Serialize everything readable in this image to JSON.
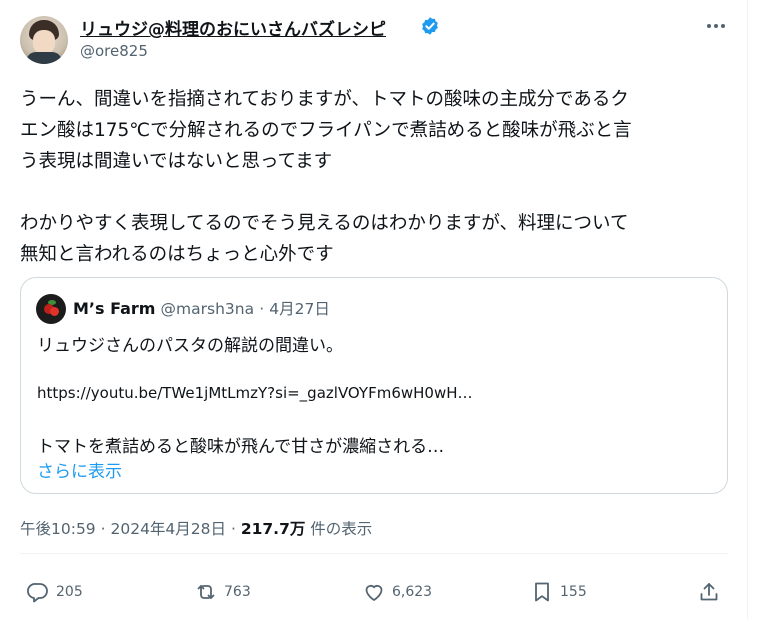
{
  "author": {
    "display_name": "リュウジ@料理のおにいさんバズレシピ",
    "handle": "@ore825"
  },
  "tweet": {
    "lines_p1": [
      "うーん、間違いを指摘されておりますが、トマトの酸味の主成分であるク",
      "エン酸は175℃で分解されるのでフライパンで煮詰めると酸味が飛ぶと言",
      "う表現は間違いではないと思ってます"
    ],
    "lines_p2": [
      "わかりやすく表現してるのでそう見えるのはわかりますが、料理について",
      "無知と言われるのはちょっと心外です"
    ]
  },
  "quote": {
    "name": "M’s Farm",
    "handle": "@marsh3na",
    "sep": "·",
    "date": "4月27日",
    "line1": "リュウジさんのパスタの解説の間違い。",
    "url": "https://youtu.be/TWe1jMtLmzY?si=_gazlVOYFm6wH0wH…",
    "line2": "トマトを煮詰めると酸味が飛んで甘さが濃縮される…",
    "show_more": "さらに表示"
  },
  "meta": {
    "time": "午後10:59",
    "sep": "·",
    "date": "2024年4月28日",
    "views_count": "217.7万",
    "views_label": "件の表示"
  },
  "actions": {
    "replies": "205",
    "reposts": "763",
    "likes": "6,623",
    "bookmarks": "155"
  },
  "colors": {
    "text": "#0f1419",
    "secondary": "#536471",
    "link": "#1d9bf0",
    "verified": "#1d9bf0",
    "border": "#cfd9de"
  },
  "icons": [
    "more-icon",
    "verified-badge-icon",
    "reply-icon",
    "repost-icon",
    "like-icon",
    "bookmark-icon",
    "share-icon"
  ]
}
